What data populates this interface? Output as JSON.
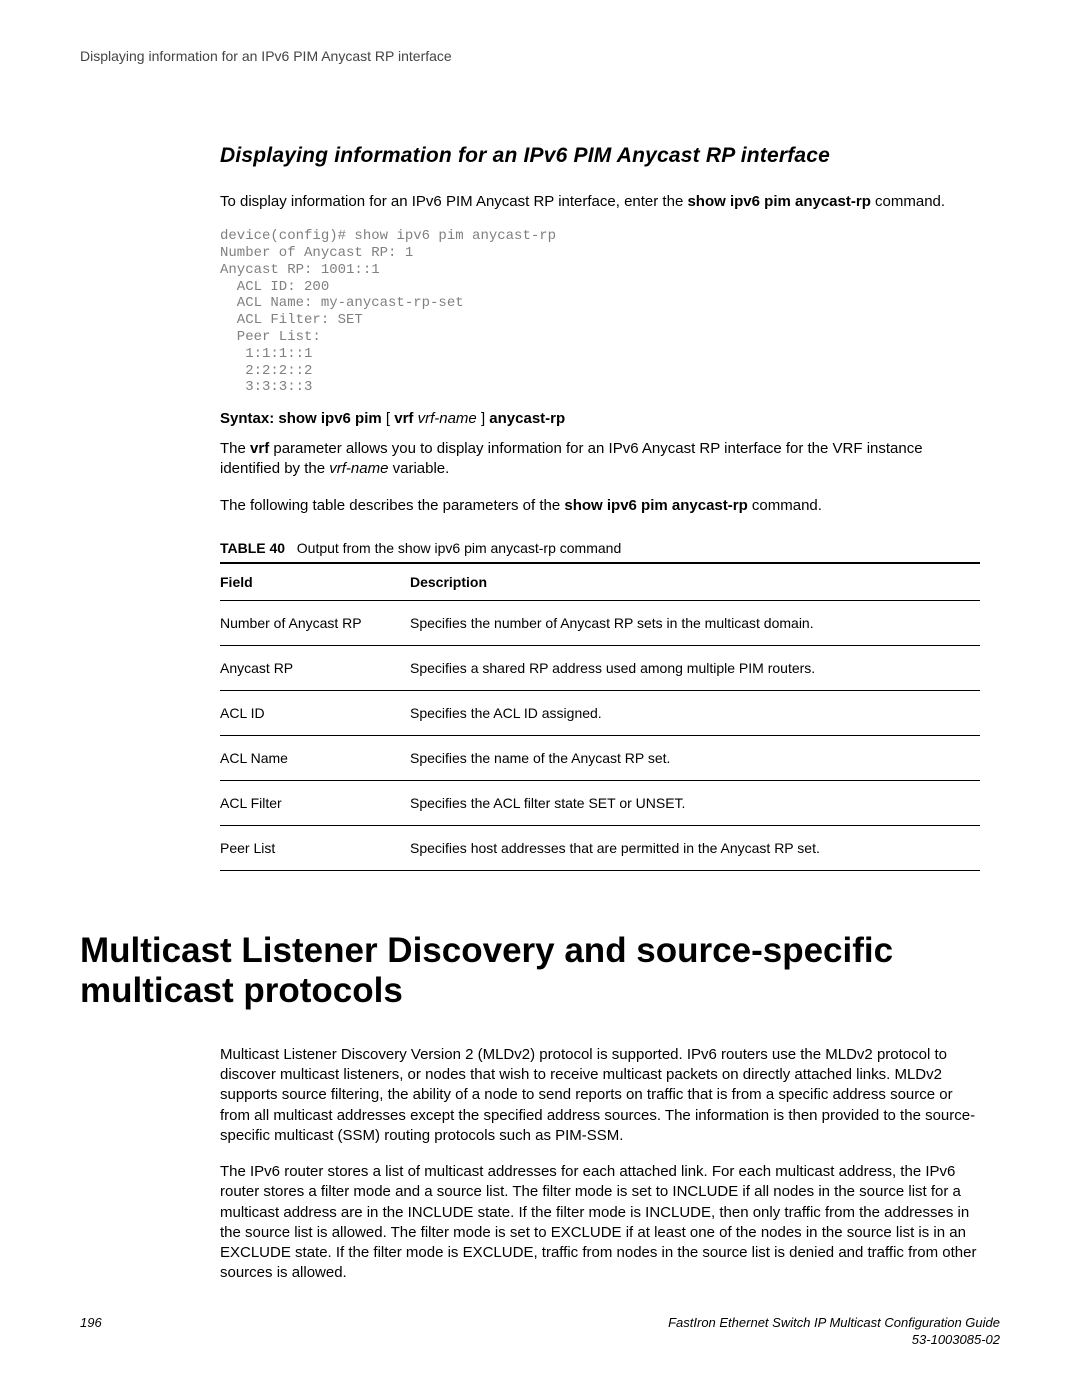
{
  "header": {
    "running": "Displaying information for an IPv6 PIM Anycast RP interface"
  },
  "section1": {
    "title": "Displaying information for an IPv6 PIM Anycast RP interface",
    "intro_pre": "To display information for an IPv6 PIM Anycast RP interface, enter the ",
    "intro_cmd": "show ipv6 pim anycast-rp",
    "intro_post": " command.",
    "cli": "device(config)# show ipv6 pim anycast-rp\nNumber of Anycast RP: 1\nAnycast RP: 1001::1\n  ACL ID: 200\n  ACL Name: my-anycast-rp-set\n  ACL Filter: SET\n  Peer List:\n   1:1:1::1\n   2:2:2::2\n   3:3:3::3",
    "syntax": {
      "label": "Syntax:",
      "cmd1": "show ipv6 pim",
      "opt_open": "[",
      "vrf_kw": "vrf",
      "vrf_arg": "vrf-name",
      "opt_close": "]",
      "cmd2": "anycast-rp"
    },
    "vrf_para_a": "The ",
    "vrf_para_b": "vrf",
    "vrf_para_c": " parameter allows you to display information for an IPv6 Anycast RP interface for the VRF instance identified by the ",
    "vrf_para_d": "vrf-name",
    "vrf_para_e": " variable.",
    "table_lead_a": "The following table describes the parameters of the ",
    "table_lead_cmd": "show ipv6 pim anycast-rp",
    "table_lead_b": " command.",
    "table_caption_no": "TABLE 40",
    "table_caption_txt": "Output from the show ipv6 pim anycast-rp command",
    "th_field": "Field",
    "th_desc": "Description",
    "rows": [
      {
        "field": "Number of Anycast RP",
        "desc": "Specifies the number of Anycast RP sets in the multicast domain."
      },
      {
        "field": "Anycast RP",
        "desc": "Specifies a shared RP address used among multiple PIM routers."
      },
      {
        "field": "ACL ID",
        "desc": "Specifies the ACL ID assigned."
      },
      {
        "field": "ACL Name",
        "desc": "Specifies the name of the Anycast RP set."
      },
      {
        "field": "ACL Filter",
        "desc": "Specifies the ACL filter state SET or UNSET."
      },
      {
        "field": "Peer List",
        "desc": "Specifies host addresses that are permitted in the Anycast RP set."
      }
    ]
  },
  "section2": {
    "title": "Multicast Listener Discovery and source-specific multicast protocols",
    "para1": "Multicast Listener Discovery Version 2 (MLDv2) protocol is supported. IPv6 routers use the MLDv2 protocol to discover multicast listeners, or nodes that wish to receive multicast packets on directly attached links. MLDv2 supports source filtering, the ability of a node to send reports on traffic that is from a specific address source or from all multicast addresses except the specified address sources. The information is then provided to the source-specific multicast (SSM) routing protocols such as PIM-SSM.",
    "para2": "The IPv6 router stores a list of multicast addresses for each attached link. For each multicast address, the IPv6 router stores a filter mode and a source list. The filter mode is set to INCLUDE if all nodes in the source list for a multicast address are in the INCLUDE state. If the filter mode is INCLUDE, then only traffic from the addresses in the source list is allowed. The filter mode is set to EXCLUDE if at least one of the nodes in the source list is in an EXCLUDE state. If the filter mode is EXCLUDE, traffic from nodes in the source list is denied and traffic from other sources is allowed."
  },
  "footer": {
    "page": "196",
    "book": "FastIron Ethernet Switch IP Multicast Configuration Guide",
    "docnum": "53-1003085-02"
  }
}
